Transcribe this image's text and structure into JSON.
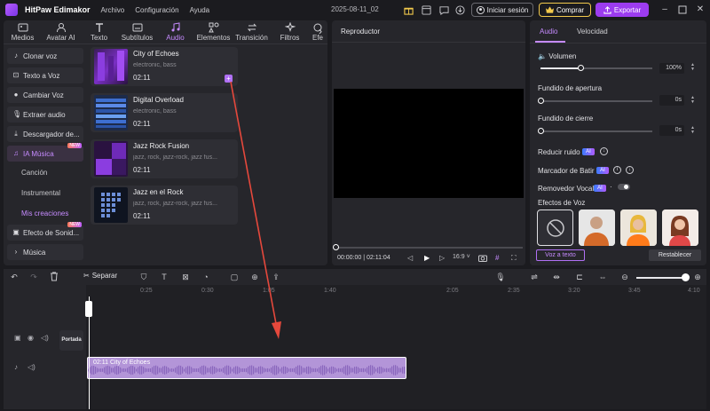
{
  "titlebar": {
    "app_name": "HitPaw Edimakor",
    "menu": [
      "Archivo",
      "Configuración",
      "Ayuda"
    ],
    "date": "2025-08-11_02",
    "login": "Iniciar sesión",
    "buy": "Comprar",
    "export": "Exportar"
  },
  "main_tabs": [
    {
      "label": "Medios",
      "icon": "media-icon"
    },
    {
      "label": "Avatar AI",
      "icon": "avatar-icon"
    },
    {
      "label": "Texto",
      "icon": "text-icon"
    },
    {
      "label": "Subtítulos",
      "icon": "subtitles-icon"
    },
    {
      "label": "Audio",
      "icon": "music-note-icon"
    },
    {
      "label": "Elementos",
      "icon": "elements-icon"
    },
    {
      "label": "Transición",
      "icon": "transition-icon"
    },
    {
      "label": "Filtros",
      "icon": "filters-icon"
    },
    {
      "label": "Efe",
      "icon": "effects-icon"
    }
  ],
  "sidebar": {
    "items": [
      {
        "label": "Clonar voz"
      },
      {
        "label": "Texto a Voz"
      },
      {
        "label": "Cambiar Voz"
      },
      {
        "label": "Extraer audio"
      },
      {
        "label": "Descargador de..."
      },
      {
        "label": "IA Música",
        "badge": "NEW"
      },
      {
        "label": "Efecto de Sonid...",
        "badge": "NEW"
      },
      {
        "label": "Música"
      }
    ],
    "sub_items": [
      "Canción",
      "Instrumental",
      "Mis creaciones"
    ]
  },
  "tracks": [
    {
      "title": "City of Echoes",
      "tags": "electronic, bass",
      "duration": "02:11"
    },
    {
      "title": "Digital Overload",
      "tags": "electronic, bass",
      "duration": "02:11"
    },
    {
      "title": "Jazz Rock Fusion",
      "tags": "jazz, rock, jazz-rock, jazz fus...",
      "duration": "02:11"
    },
    {
      "title": "Jazz en el Rock",
      "tags": "jazz, rock, jazz-rock, jazz fus...",
      "duration": "02:11"
    }
  ],
  "player": {
    "title": "Reproductor",
    "time_current": "00:00:00",
    "time_total": "02:11:04",
    "ratio": "16:9"
  },
  "audio_panel": {
    "tabs": [
      "Audio",
      "Velocidad"
    ],
    "volume_label": "Volumen",
    "volume_value": "100%",
    "volume_level": 0.36,
    "fade_in_label": "Fundido de apertura",
    "fade_in_value": "0s",
    "fade_out_label": "Fundido de cierre",
    "fade_out_value": "0s",
    "noise_label": "Reducir ruido",
    "beat_label": "Marcador de Batir",
    "vocal_label": "Removedor Vocal",
    "ai_badge": "AI",
    "effects_label": "Efectos de Voz",
    "voice_to_text": "Voz a texto",
    "reset": "Restablecer"
  },
  "timeline_toolbar": {
    "split": "Separar"
  },
  "timeline": {
    "ticks": [
      "0:25",
      "0:30",
      "1:05",
      "1:40",
      "2:05",
      "2:35",
      "3:20",
      "3:45",
      "4:10"
    ],
    "cover": "Portada",
    "clip_label": "02:11 City of Echoes"
  },
  "colors": {
    "accent": "#c68bff",
    "export": "#9c3cf0",
    "clip": "#b395d8",
    "annotation_arrow": "#e5483c"
  }
}
